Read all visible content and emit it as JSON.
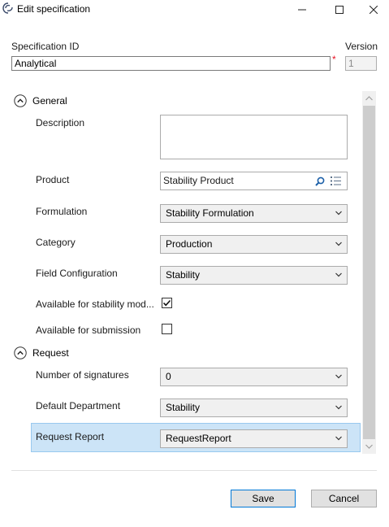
{
  "window": {
    "title": "Edit specification"
  },
  "header": {
    "spec_id_label": "Specification ID",
    "spec_id_value": "Analytical",
    "required_marker": "*",
    "version_label": "Version",
    "version_value": "1"
  },
  "general": {
    "title": "General",
    "description_label": "Description",
    "description_value": "",
    "product_label": "Product",
    "product_value": "Stability Product",
    "formulation_label": "Formulation",
    "formulation_value": "Stability Formulation",
    "category_label": "Category",
    "category_value": "Production",
    "field_config_label": "Field Configuration",
    "field_config_value": "Stability",
    "stability_mode_label": "Available for stability mod...",
    "stability_mode_checked": true,
    "submission_label": "Available for submission",
    "submission_checked": false
  },
  "request": {
    "title": "Request",
    "signatures_label": "Number of signatures",
    "signatures_value": "0",
    "department_label": "Default Department",
    "department_value": "Stability",
    "report_label": "Request Report",
    "report_value": "RequestReport"
  },
  "footer": {
    "save_label": "Save",
    "cancel_label": "Cancel"
  },
  "colors": {
    "selection_bg": "#cce4f7",
    "primary_border": "#0078d7",
    "required": "#e81123"
  }
}
